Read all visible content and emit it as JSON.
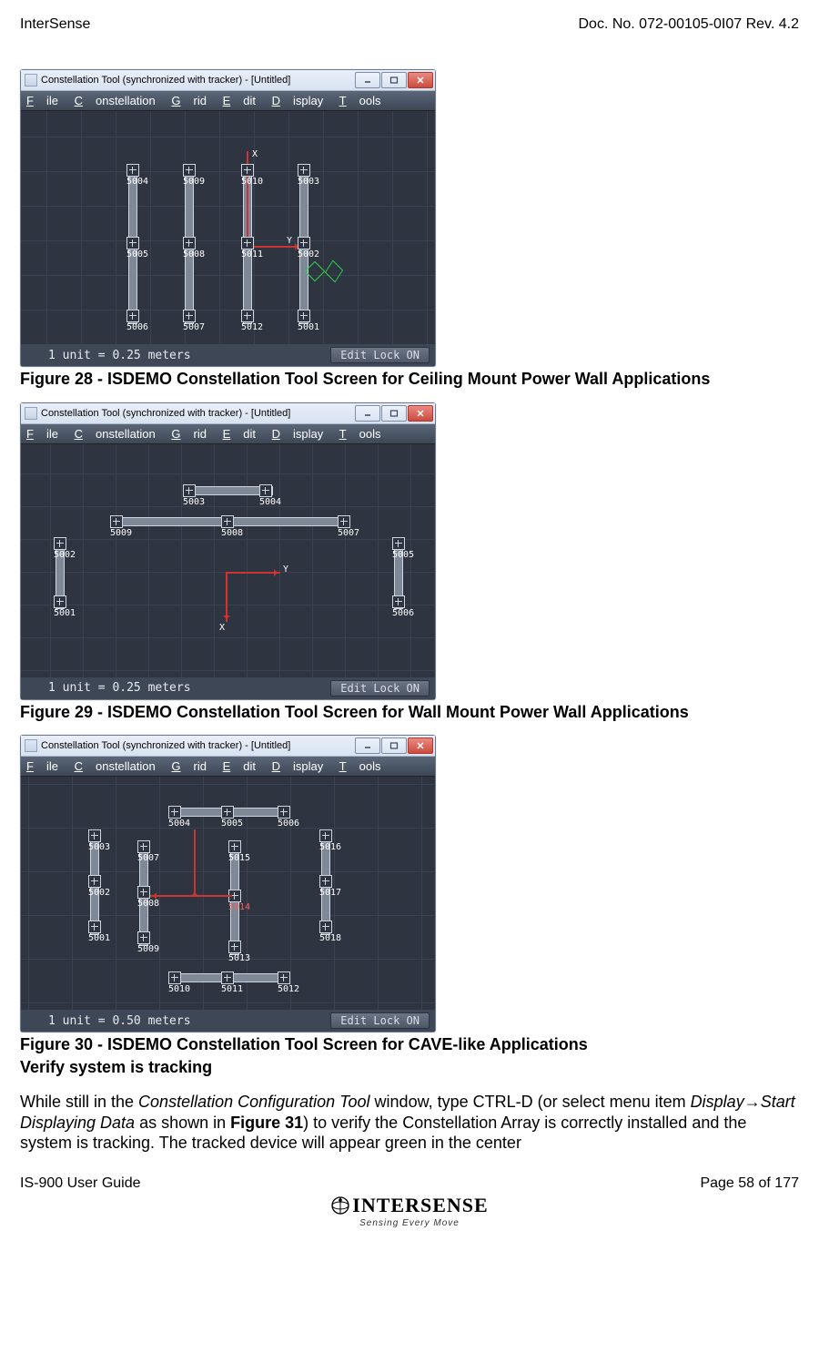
{
  "header": {
    "left": "InterSense",
    "right": "Doc. No. 072-00105-0I07 Rev. 4.2"
  },
  "footer": {
    "left": "IS-900 User Guide",
    "right": "Page 58 of 177"
  },
  "logo": {
    "name": "INTERSENSE",
    "tag": "Sensing Every Move"
  },
  "app": {
    "title": "Constellation Tool (synchronized with tracker) - [Untitled]",
    "menu": {
      "file": "File",
      "constellation": "Constellation",
      "grid": "Grid",
      "edit": "Edit",
      "display": "Display",
      "tools": "Tools"
    },
    "status_unit_025": "1 unit = 0.25 meters",
    "status_unit_050": "1 unit = 0.50 meters",
    "status_lock": "Edit Lock ON",
    "axis_y_label": "Y",
    "axis_x_label": "X"
  },
  "captions": {
    "fig28": "Figure 28 - ISDEMO Constellation Tool Screen for Ceiling Mount Power Wall Applications",
    "fig29": "Figure 29 - ISDEMO Constellation Tool Screen for Wall Mount Power Wall Applications",
    "fig30a": "Figure 30 - ISDEMO Constellation Tool Screen for CAVE-like Applications",
    "fig30b": "Verify system is tracking"
  },
  "body": {
    "p1_a": "While still in the ",
    "p1_i1": "Constellation Configuration Tool",
    "p1_b": " window, type CTRL-D (or select menu item ",
    "p1_i2": "Display→Start Displaying Data",
    "p1_c": " as shown in ",
    "p1_bold": "Figure 31",
    "p1_d": ") to verify the Constellation Array is correctly installed and the system is tracking.  The tracked device will appear green in the center"
  },
  "fig28_nodes": {
    "n5004": "5004",
    "n5009": "5009",
    "n5010": "5010",
    "n5003": "5003",
    "n5005": "5005",
    "n5008": "5008",
    "n5011": "5011",
    "n5002": "5002",
    "n5006": "5006",
    "n5007": "5007",
    "n5012": "5012",
    "n5001": "5001"
  },
  "fig29_nodes": {
    "n5003": "5003",
    "n5004": "5004",
    "n5009": "5009",
    "n5008": "5008",
    "n5007": "5007",
    "n5002": "5002",
    "n5005": "5005",
    "n5001": "5001",
    "n5006": "5006"
  },
  "fig30_nodes": {
    "n5004": "5004",
    "n5005": "5005",
    "n5006": "5006",
    "n5003": "5003",
    "n5007": "5007",
    "n5015": "5015",
    "n5016": "5016",
    "n5002": "5002",
    "n5008": "5008",
    "n5014": "5014",
    "n5017": "5017",
    "n5001": "5001",
    "n5009": "5009",
    "n5013": "5013",
    "n5018": "5018",
    "n5010": "5010",
    "n5011": "5011",
    "n5012": "5012"
  }
}
